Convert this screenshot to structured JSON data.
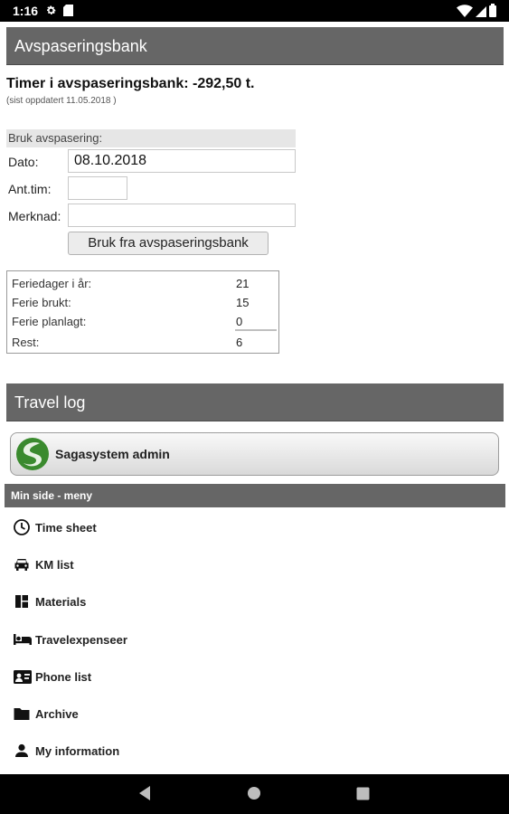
{
  "status_bar": {
    "time": "1:16"
  },
  "bank_section": {
    "header": "Avspaseringsbank",
    "total": "Timer i avspaseringsbank: -292,50 t.",
    "updated": "(sist oppdatert 11.05.2018 )"
  },
  "use_form": {
    "title": "Bruk avspasering:",
    "date_label": "Dato:",
    "date_value": "08.10.2018",
    "hours_label": "Ant.tim:",
    "hours_value": "",
    "note_label": "Merknad:",
    "note_value": "",
    "submit_label": "Bruk fra avspaseringsbank"
  },
  "holidays": {
    "rows": [
      {
        "label": "Feriedager i år:",
        "value": "21"
      },
      {
        "label": "Ferie brukt:",
        "value": "15"
      },
      {
        "label": "Ferie planlagt:",
        "value": "0"
      },
      {
        "label": "Rest:",
        "value": "6"
      }
    ]
  },
  "travel_section": {
    "header": "Travel log"
  },
  "admin_button": {
    "label": "Sagasystem admin"
  },
  "menu": {
    "header": "Min side - meny",
    "items": [
      {
        "label": "Time sheet",
        "icon": "clock-icon"
      },
      {
        "label": "KM list",
        "icon": "car-icon"
      },
      {
        "label": "Materials",
        "icon": "dashboard-icon"
      },
      {
        "label": "Travelexpenseer",
        "icon": "bed-icon"
      },
      {
        "label": "Phone list",
        "icon": "contact-card-icon"
      },
      {
        "label": "Archive",
        "icon": "folder-icon"
      },
      {
        "label": "My information",
        "icon": "person-icon"
      }
    ]
  },
  "colors": {
    "header_bg": "#666666",
    "status_bar": "#000000",
    "logo_green": "#3a8a2e"
  }
}
